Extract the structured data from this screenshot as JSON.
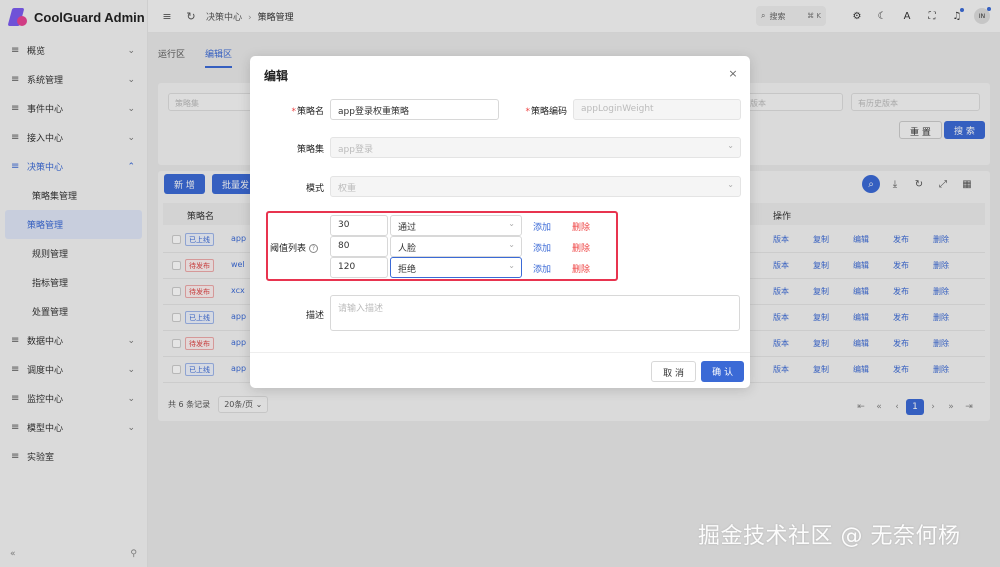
{
  "app": {
    "title": "CoolGuard Admin"
  },
  "sidebar": {
    "items": [
      {
        "label": "概览",
        "icon": "menu-icon",
        "chev": "⌄"
      },
      {
        "label": "系统管理",
        "icon": "menu-icon",
        "chev": "⌄"
      },
      {
        "label": "事件中心",
        "icon": "menu-icon",
        "chev": "⌄"
      },
      {
        "label": "接入中心",
        "icon": "menu-icon",
        "chev": "⌄"
      },
      {
        "label": "决策中心",
        "icon": "menu-icon",
        "chev": "⌃",
        "open": true
      }
    ],
    "sub_items": [
      {
        "label": "策略集管理"
      },
      {
        "label": "策略管理",
        "active": true
      },
      {
        "label": "规则管理"
      },
      {
        "label": "指标管理"
      },
      {
        "label": "处置管理"
      }
    ],
    "items_after": [
      {
        "label": "数据中心",
        "chev": "⌄"
      },
      {
        "label": "调度中心",
        "chev": "⌄"
      },
      {
        "label": "监控中心",
        "chev": "⌄"
      },
      {
        "label": "模型中心",
        "chev": "⌄"
      },
      {
        "label": "实验室",
        "chev": ""
      }
    ],
    "collapse_glyph": "«",
    "pin_glyph": "⚲"
  },
  "header": {
    "breadcrumb": [
      "决策中心",
      "策略管理"
    ],
    "search_label": "搜索",
    "search_shortcut": "⌘ K",
    "avatar_text": "IN"
  },
  "main": {
    "tabs": [
      {
        "label": "运行区"
      },
      {
        "label": "编辑区",
        "active": true
      }
    ],
    "filter": {
      "policy_set_placeholder": "策略集",
      "version_placeholder": "版本",
      "history_placeholder": "有历史版本",
      "reset_label": "重 置",
      "search_label": "搜 索"
    },
    "table": {
      "add_label": "新 增",
      "batch_label": "批量发",
      "col_name": "策略名",
      "col_ops": "操作",
      "rows": [
        {
          "status": "已上线",
          "status_type": "on",
          "name": "app"
        },
        {
          "status": "待发布",
          "status_type": "pend",
          "name": "wel"
        },
        {
          "status": "待发布",
          "status_type": "pend",
          "name": "xcx"
        },
        {
          "status": "已上线",
          "status_type": "on",
          "name": "app"
        },
        {
          "status": "待发布",
          "status_type": "pend",
          "name": "app"
        },
        {
          "status": "已上线",
          "status_type": "on",
          "name": "app"
        }
      ],
      "ops": [
        "版本",
        "复制",
        "编辑",
        "发布",
        "删除"
      ],
      "total_label": "共 6 条记录",
      "page_size": "20条/页",
      "current_page": "1"
    }
  },
  "modal": {
    "title": "编辑",
    "close_glyph": "×",
    "name_label": "策略名",
    "name_value": "app登录权重策略",
    "code_label": "策略编码",
    "code_value": "appLoginWeight",
    "set_label": "策略集",
    "set_value": "app登录",
    "mode_label": "模式",
    "mode_value": "权重",
    "threshold_label": "阈值列表",
    "thresholds": [
      {
        "value": "30",
        "action": "通过"
      },
      {
        "value": "80",
        "action": "人脸"
      },
      {
        "value": "120",
        "action": "拒绝"
      }
    ],
    "add_label": "添加",
    "delete_label": "删除",
    "desc_label": "描述",
    "desc_placeholder": "请输入描述",
    "cancel_label": "取 消",
    "ok_label": "确 认"
  },
  "watermark": "掘金技术社区 @ 无奈何杨",
  "colors": {
    "accent": "#3b6ad6",
    "danger": "#e44444",
    "highlight_border": "#e8344f"
  }
}
